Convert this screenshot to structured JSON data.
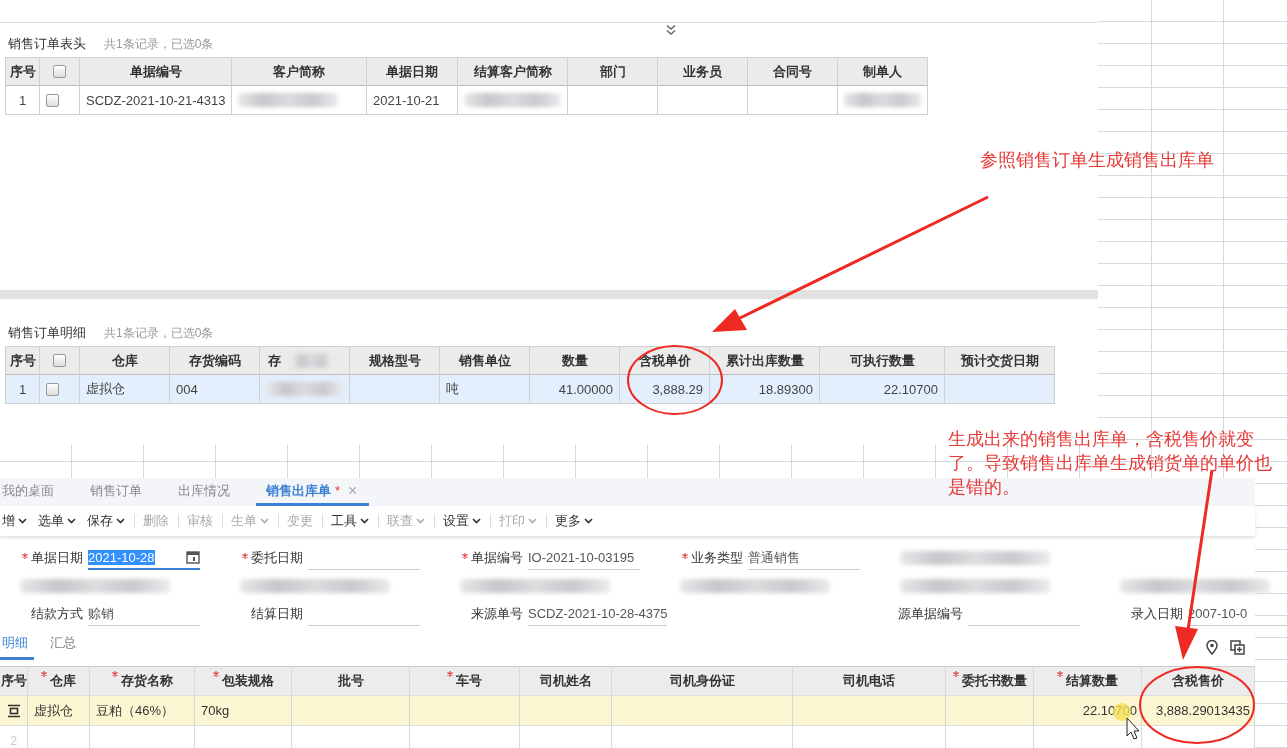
{
  "order_header": {
    "title": "销售订单表头",
    "summary": "共1条记录，已选0条",
    "header_checked": false,
    "columns": [
      "序号",
      "单据编号",
      "客户简称",
      "单据日期",
      "结算客户简称",
      "部门",
      "业务员",
      "合同号",
      "制单人"
    ],
    "rows": [
      {
        "checked": false,
        "selected": false,
        "cells": [
          {
            "kind": "text",
            "text": "1"
          },
          {
            "kind": "text",
            "text": "SCDZ-2021-10-21-4313"
          },
          {
            "kind": "blur"
          },
          {
            "kind": "text",
            "text": "2021-10-21"
          },
          {
            "kind": "blur"
          },
          {
            "kind": "empty"
          },
          {
            "kind": "empty"
          },
          {
            "kind": "empty"
          },
          {
            "kind": "blur"
          }
        ]
      }
    ]
  },
  "order_detail": {
    "title": "销售订单明细",
    "summary": "共1条记录，已选0条",
    "header_checked": false,
    "columns": [
      "序号",
      "仓库",
      "存货编码",
      "存",
      "规格型号",
      "销售单位",
      "数量",
      "含税单价",
      "累计出库数量",
      "可执行数量",
      "预计交货日期"
    ],
    "rows": [
      {
        "checked": false,
        "selected": true,
        "cells": [
          {
            "kind": "text",
            "text": "1"
          },
          {
            "kind": "text",
            "text": "虚拟仓"
          },
          {
            "kind": "text",
            "text": "004"
          },
          {
            "kind": "blur"
          },
          {
            "kind": "empty"
          },
          {
            "kind": "text",
            "text": "吨"
          },
          {
            "kind": "text",
            "text": "41.00000"
          },
          {
            "kind": "text",
            "text": "3,888.29"
          },
          {
            "kind": "text",
            "text": "18.89300"
          },
          {
            "kind": "text",
            "text": "22.10700"
          },
          {
            "kind": "empty"
          }
        ]
      }
    ]
  },
  "annotations": [
    {
      "text": "参照销售订单生成销售出库单"
    },
    {
      "text": "生成出来的销售出库单，含税售价就变了。导致销售出库单生成销货单的单价也是错的。"
    }
  ],
  "tabs": [
    {
      "label": "我的桌面",
      "selected": false
    },
    {
      "label": "销售订单",
      "selected": false
    },
    {
      "label": "出库情况",
      "selected": false
    },
    {
      "label": "销售出库单",
      "selected": true,
      "mark": "*",
      "close": "×"
    }
  ],
  "toolbar": [
    {
      "label": "增",
      "dropdown": true,
      "disabled": false
    },
    {
      "label": "选单",
      "dropdown": true,
      "disabled": false
    },
    {
      "label": "保存",
      "dropdown": true,
      "disabled": false
    },
    {
      "label": "删除",
      "dropdown": false,
      "disabled": true
    },
    {
      "label": "审核",
      "dropdown": false,
      "disabled": true
    },
    {
      "label": "生单",
      "dropdown": true,
      "disabled": true
    },
    {
      "label": "变更",
      "dropdown": false,
      "disabled": true
    },
    {
      "label": "工具",
      "dropdown": true,
      "disabled": false
    },
    {
      "label": "联查",
      "dropdown": true,
      "disabled": true
    },
    {
      "label": "设置",
      "dropdown": true,
      "disabled": false
    },
    {
      "label": "打印",
      "dropdown": true,
      "disabled": true
    },
    {
      "label": "更多",
      "dropdown": true,
      "disabled": false
    }
  ],
  "form": [
    [
      {
        "kind": "date",
        "label": "单据日期",
        "required": true,
        "value": "2021-10-28"
      },
      {
        "kind": "text",
        "label": "委托日期",
        "required": true
      },
      {
        "kind": "text",
        "label": "单据编号",
        "required": true,
        "value": "IO-2021-10-03195"
      },
      {
        "kind": "text",
        "label": "业务类型",
        "required": true,
        "value": "普通销售"
      },
      {
        "kind": "blur"
      },
      {
        "kind": "empty"
      }
    ],
    [
      {
        "kind": "blur"
      },
      {
        "kind": "blur"
      },
      {
        "kind": "blur"
      },
      {
        "kind": "blur"
      },
      {
        "kind": "blur"
      },
      {
        "kind": "blur"
      }
    ],
    [
      {
        "kind": "text",
        "label": "结款方式",
        "required": false,
        "value": "赊销"
      },
      {
        "kind": "text",
        "label": "结算日期",
        "required": false
      },
      {
        "kind": "text",
        "label": "来源单号",
        "required": false,
        "value": "SCDZ-2021-10-28-4375"
      },
      {
        "kind": "empty"
      },
      {
        "kind": "text",
        "label": "源单据编号",
        "required": false
      },
      {
        "kind": "text",
        "label": "录入日期",
        "required": false,
        "value": "2007-10-0"
      }
    ]
  ],
  "sub_tabs": [
    {
      "label": "明细",
      "selected": true
    },
    {
      "label": "汇总",
      "selected": false
    }
  ],
  "grid": {
    "columns": [
      {
        "label": "序号",
        "required": false
      },
      {
        "label": "仓库",
        "required": true
      },
      {
        "label": "存货名称",
        "required": true
      },
      {
        "label": "包装规格",
        "required": true
      },
      {
        "label": "批号",
        "required": false
      },
      {
        "label": "车号",
        "required": true
      },
      {
        "label": "司机姓名",
        "required": false
      },
      {
        "label": "司机身份证",
        "required": false
      },
      {
        "label": "司机电话",
        "required": false
      },
      {
        "label": "委托书数量",
        "required": true
      },
      {
        "label": "结算数量",
        "required": true
      },
      {
        "label": "含税售价",
        "required": false
      }
    ],
    "rows": [
      {
        "selected": true,
        "cells": [
          {
            "kind": "icon"
          },
          {
            "kind": "text",
            "text": "虚拟仓"
          },
          {
            "kind": "text",
            "text": "豆粕（46%）"
          },
          {
            "kind": "text",
            "text": "70kg"
          },
          {
            "kind": "empty"
          },
          {
            "kind": "empty"
          },
          {
            "kind": "empty"
          },
          {
            "kind": "empty"
          },
          {
            "kind": "empty"
          },
          {
            "kind": "empty"
          },
          {
            "kind": "text",
            "text": "22.10700"
          },
          {
            "kind": "text",
            "text": "3,888.29013435"
          }
        ]
      },
      {
        "selected": false,
        "cells": [
          {
            "kind": "text",
            "text": "2"
          },
          {
            "kind": "empty"
          },
          {
            "kind": "empty"
          },
          {
            "kind": "empty"
          },
          {
            "kind": "empty"
          },
          {
            "kind": "empty"
          },
          {
            "kind": "empty"
          },
          {
            "kind": "empty"
          },
          {
            "kind": "empty"
          },
          {
            "kind": "empty"
          },
          {
            "kind": "empty"
          },
          {
            "kind": "empty"
          }
        ]
      }
    ]
  }
}
